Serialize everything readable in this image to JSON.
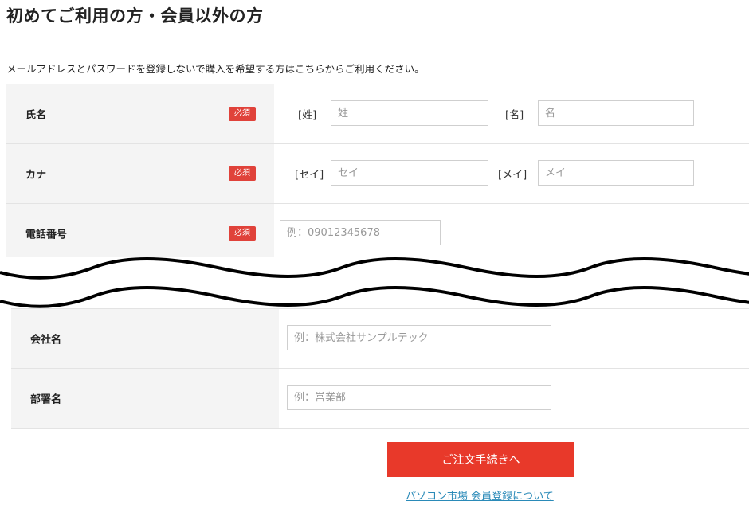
{
  "page": {
    "title": "初めてご利用の方・会員以外の方",
    "intro": "メールアドレスとパスワードを登録しないで購入を希望する方はこちらからご利用ください。"
  },
  "form": {
    "required_label": "必須",
    "name": {
      "label": "氏名",
      "sei_label": "[姓]",
      "sei_placeholder": "姓",
      "mei_label": "[名]",
      "mei_placeholder": "名"
    },
    "kana": {
      "label": "カナ",
      "sei_label": "[セイ]",
      "sei_placeholder": "セイ",
      "mei_label": "[メイ]",
      "mei_placeholder": "メイ"
    },
    "phone": {
      "label": "電話番号",
      "placeholder": "例：09012345678"
    },
    "company": {
      "label": "会社名",
      "placeholder": "例：株式会社サンプルテック"
    },
    "department": {
      "label": "部署名",
      "placeholder": "例：営業部"
    }
  },
  "actions": {
    "submit_label": "ご注文手続きへ",
    "member_link": "パソコン市場 会員登録について"
  },
  "colors": {
    "accent": "#e8392a",
    "required_badge": "#e0423a",
    "link": "#2a8ab8"
  }
}
